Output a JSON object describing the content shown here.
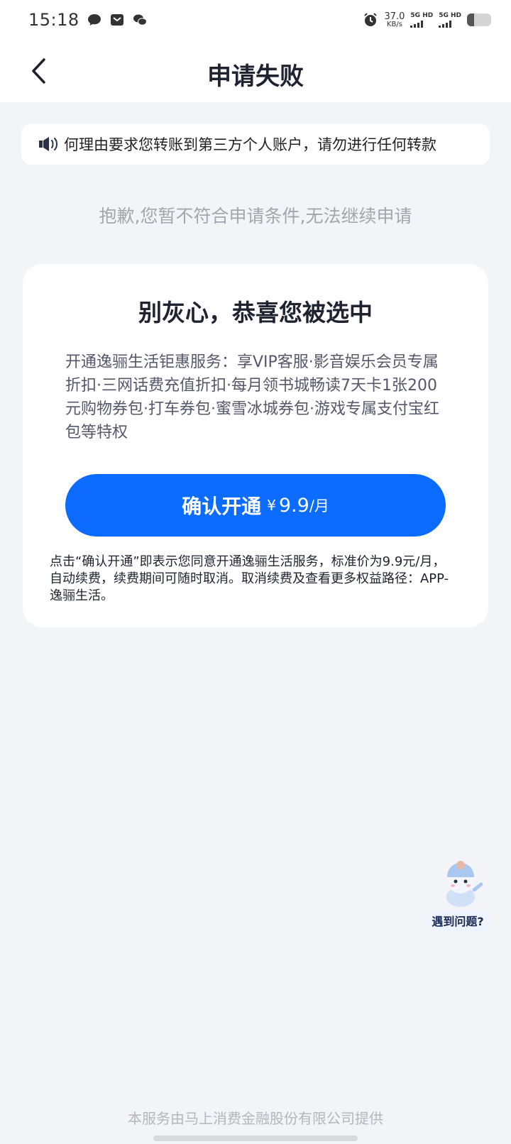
{
  "status_bar": {
    "time": "15:18",
    "net_speed": "37.0",
    "net_speed_unit": "KB/s",
    "sim1_label": "5G HD",
    "sim2_label": "5G HD",
    "battery_level": 0.3,
    "icons": [
      "chat-bubble-icon",
      "mail-icon",
      "wechat-icon",
      "alarm-icon"
    ]
  },
  "nav": {
    "title": "申请失败",
    "back_icon": "chevron-left-icon"
  },
  "notice": {
    "icon": "speaker-icon",
    "text": "何理由要求您转账到第三方个人账户，请勿进行任何转款"
  },
  "fail_message": "抱歉,您暂不符合申请条件,无法继续申请",
  "card": {
    "title": "别灰心，恭喜您被选中",
    "description": "开通逸骊生活钜惠服务：享VIP客服·影音娱乐会员专属折扣·三网话费充值折扣·每月领书城畅读7天卡1张200元购物券包·打车券包·蜜雪冰城券包·游戏专属支付宝红包等特权",
    "button": {
      "label": "确认开通",
      "currency": "¥",
      "price": "9.9",
      "period": "/月"
    },
    "note": "点击“确认开通”即表示您同意开通逸骊生活服务，标准价为9.9元/月，自动续费，续费期间可随时取消。取消续费及查看更多权益路径：APP-逸骊生活。"
  },
  "help": {
    "label": "遇到问题?"
  },
  "footer": "本服务由马上消费金融股份有限公司提供",
  "colors": {
    "primary": "#0b6cff",
    "background": "#f3f4f7"
  }
}
